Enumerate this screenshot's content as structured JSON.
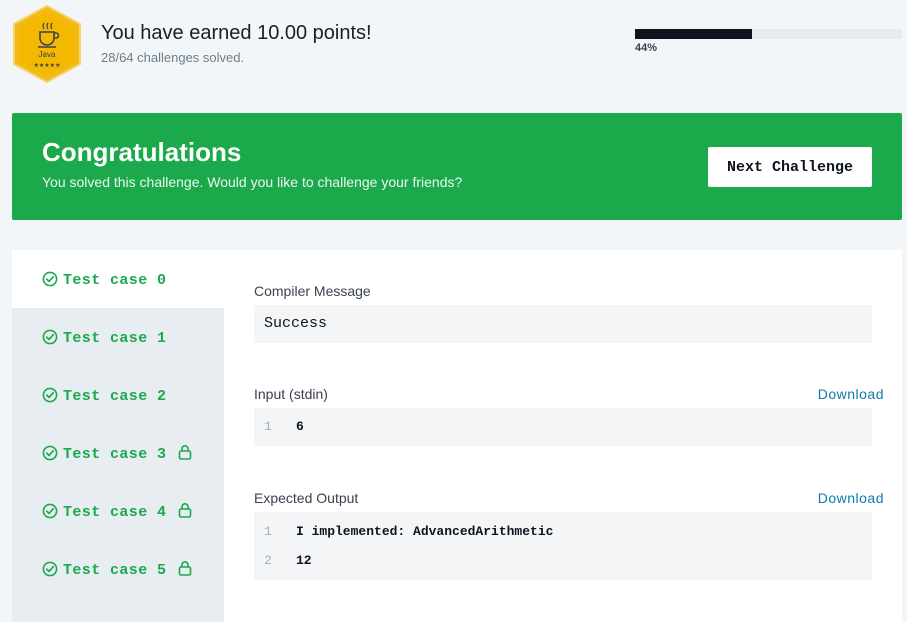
{
  "badge": {
    "language": "Java",
    "stars": "★★★★★"
  },
  "header": {
    "earned_text": "You have earned 10.00 points!",
    "solved_text": "28/64 challenges solved.",
    "progress_label": "44%",
    "progress_value": 44
  },
  "banner": {
    "title": "Congratulations",
    "message": "You solved this challenge. Would you like to challenge your friends?",
    "next_button": "Next Challenge"
  },
  "tabs": [
    {
      "label": "Test case 0",
      "locked": false,
      "active": true
    },
    {
      "label": "Test case 1",
      "locked": false,
      "active": false
    },
    {
      "label": "Test case 2",
      "locked": false,
      "active": false
    },
    {
      "label": "Test case 3",
      "locked": true,
      "active": false
    },
    {
      "label": "Test case 4",
      "locked": true,
      "active": false
    },
    {
      "label": "Test case 5",
      "locked": true,
      "active": false
    }
  ],
  "compiler": {
    "label": "Compiler Message",
    "message": "Success"
  },
  "input": {
    "label": "Input (stdin)",
    "download": "Download",
    "lines": [
      {
        "num": "1",
        "text": "6"
      }
    ]
  },
  "expected": {
    "label": "Expected Output",
    "download": "Download",
    "lines": [
      {
        "num": "1",
        "text": "I implemented: AdvancedArithmetic"
      },
      {
        "num": "2",
        "text": "12"
      }
    ]
  },
  "colors": {
    "success_green": "#1ba94c",
    "link_blue": "#0f7aa8",
    "badge_gold": "#f5b800"
  }
}
